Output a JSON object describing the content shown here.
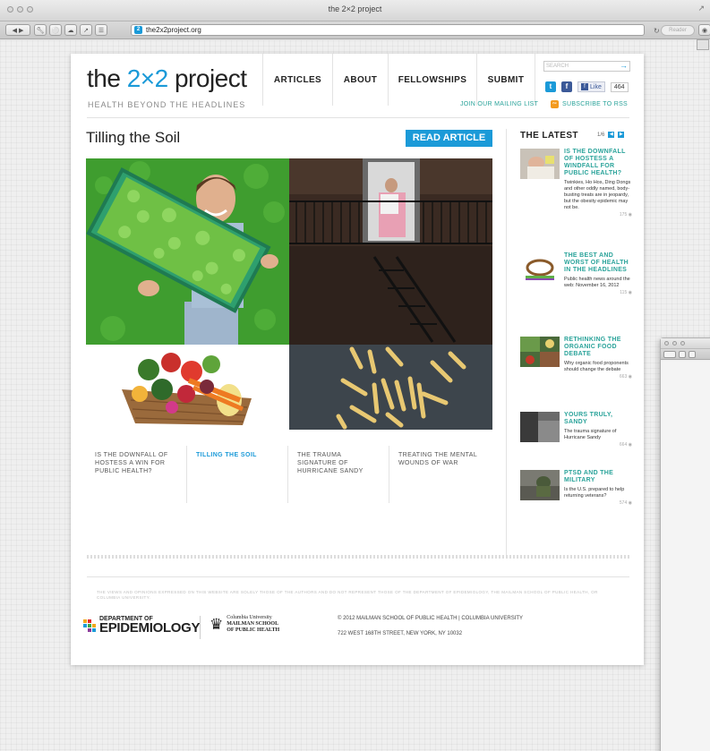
{
  "window": {
    "title": "the 2×2 project",
    "url": "the2x2project.org",
    "reader_label": "Reader"
  },
  "site": {
    "logo_prefix": "the ",
    "logo_mid": "2×2",
    "logo_suffix": " project",
    "tagline": "HEALTH BEYOND THE HEADLINES",
    "nav": [
      {
        "label": "ARTICLES"
      },
      {
        "label": "ABOUT"
      },
      {
        "label": "FELLOWSHIPS"
      },
      {
        "label": "SUBMIT"
      }
    ],
    "search_placeholder": "SEARCH",
    "like_label": "Like",
    "like_count": "464",
    "mailing_label": "JOIN OUR MAILING LIST",
    "rss_label": "SUBSCRIBE TO RSS"
  },
  "article": {
    "title": "Tilling the Soil",
    "read_button": "READ ARTICLE"
  },
  "related": [
    {
      "label": "IS THE DOWNFALL OF HOSTESS A WIN FOR PUBLIC HEALTH?",
      "active": false
    },
    {
      "label": "TILLING THE SOIL",
      "active": true
    },
    {
      "label": "THE TRAUMA SIGNATURE OF HURRICANE SANDY",
      "active": false
    },
    {
      "label": "TREATING THE MENTAL WOUNDS OF WAR",
      "active": false
    }
  ],
  "sidebar": {
    "heading": "THE LATEST",
    "pager": "1/6",
    "items": [
      {
        "title": "IS THE DOWNFALL OF HOSTESS A WINDFALL FOR PUBLIC HEALTH?",
        "desc": "Twinkies, Ho Hos, Ding Dongs and other oddly named, body-busting treats are in jeopardy, but the obesity epidemic may not be.",
        "count": "175"
      },
      {
        "title": "THE BEST AND WORST OF HEALTH IN THE HEADLINES",
        "desc": "Public health news around the web: November 16, 2012",
        "count": "115"
      },
      {
        "title": "RETHINKING THE ORGANIC FOOD DEBATE",
        "desc": "Why organic food proponents should change the debate",
        "count": "663"
      },
      {
        "title": "YOURS TRULY, SANDY",
        "desc": "The trauma signature of Hurricane Sandy",
        "count": "664"
      },
      {
        "title": "PTSD AND THE MILITARY",
        "desc": "Is the U.S. prepared to help returning veterans?",
        "count": "574"
      }
    ]
  },
  "footer": {
    "disclaimer": "THE VIEWS AND OPINIONS EXPRESSED ON THIS WEBSITE ARE SOLELY THOSE OF THE AUTHORS AND DO NOT REPRESENT THOSE OF THE DEPARTMENT OF EPIDEMIOLOGY, THE MAILMAN SCHOOL OF PUBLIC HEALTH, OR COLUMBIA UNIVERSITY.",
    "dept_line1": "DEPARTMENT OF",
    "dept_line2": "EPIDEMIOLOGY",
    "cu_line1": "Columbia University",
    "cu_line2": "MAILMAN SCHOOL",
    "cu_line3": "OF PUBLIC HEALTH",
    "copyright": "© 2012 MAILMAN SCHOOL OF PUBLIC HEALTH | COLUMBIA UNIVERSITY",
    "address": "722 WEST 168TH STREET, NEW YORK, NY 10032"
  },
  "colors": {
    "accent_blue": "#1b9ad8",
    "link_teal": "#2aa39a"
  }
}
